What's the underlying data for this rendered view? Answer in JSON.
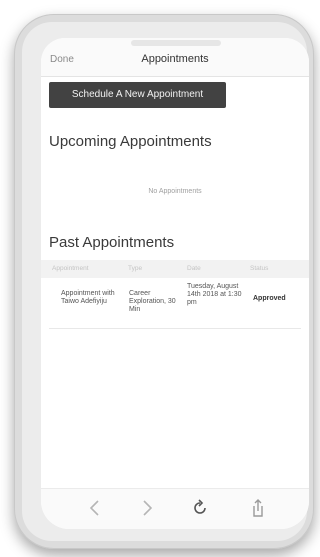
{
  "nav": {
    "done_label": "Done",
    "title": "Appointments"
  },
  "actions": {
    "schedule_label": "Schedule A New Appointment"
  },
  "upcoming": {
    "heading": "Upcoming Appointments",
    "empty_text": "No Appointments"
  },
  "past": {
    "heading": "Past Appointments",
    "columns": [
      "Appointment",
      "Type",
      "Date",
      "Status"
    ],
    "rows": [
      {
        "appointment": "Appointment with Taiwo Adefiyiju",
        "type": "Career Exploration, 30 Min",
        "date": "Tuesday, August 14th 2018 at 1:30 pm",
        "status": "Approved"
      }
    ]
  },
  "toolbar": {
    "icons": [
      "back-icon",
      "forward-icon",
      "reload-icon",
      "share-icon"
    ]
  }
}
